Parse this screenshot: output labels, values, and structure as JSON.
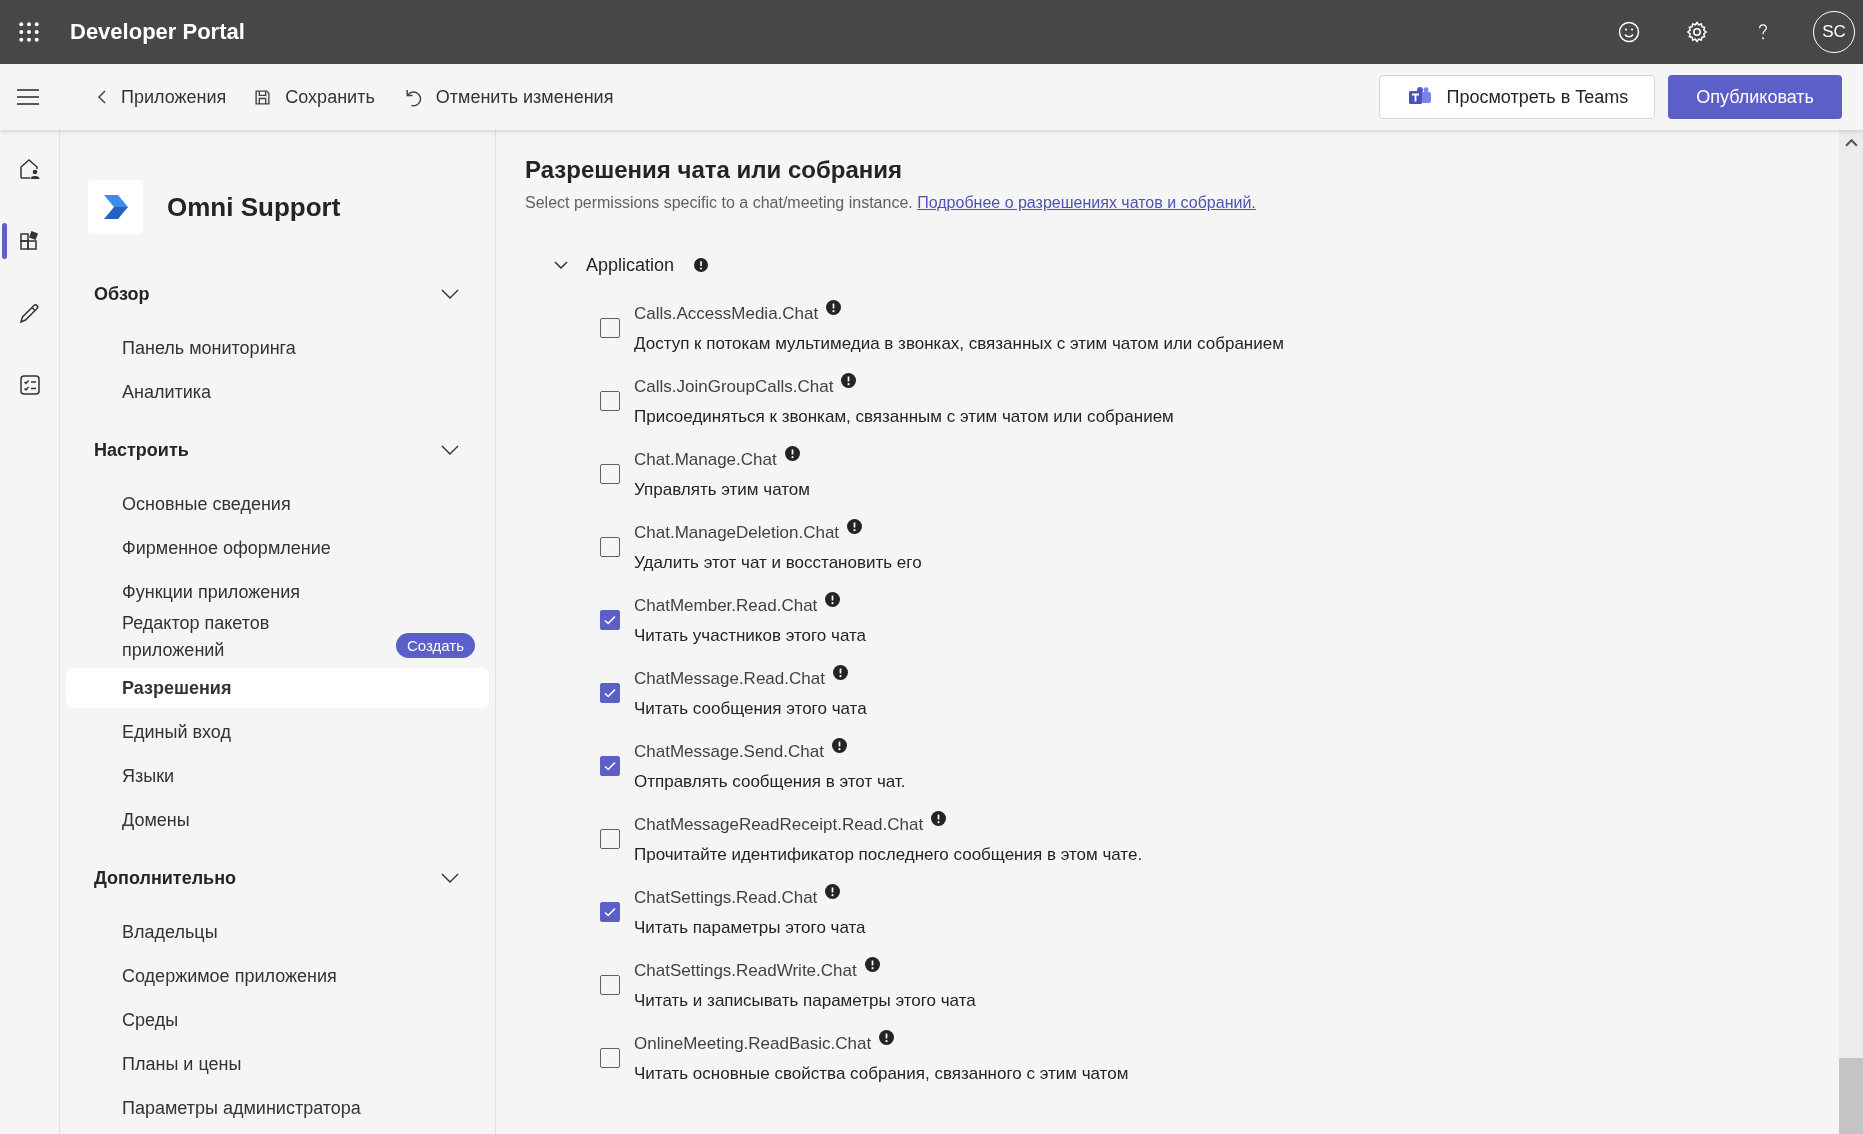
{
  "top_bar": {
    "title": "Developer Portal",
    "avatar": "SC"
  },
  "toolbar": {
    "back": "Приложения",
    "save": "Сохранить",
    "discard": "Отменить изменения",
    "preview": "Просмотреть в Teams",
    "publish": "Опубликовать"
  },
  "rail": [
    {
      "kind": "home",
      "selected": false
    },
    {
      "kind": "apps",
      "selected": true
    },
    {
      "kind": "edit",
      "selected": false
    },
    {
      "kind": "checklist",
      "selected": false
    }
  ],
  "app": {
    "name": "Omni Support"
  },
  "sidebar": [
    {
      "title": "Обзор",
      "expanded": true,
      "items": [
        {
          "label": "Панель мониторинга",
          "selected": false
        },
        {
          "label": "Аналитика",
          "selected": false
        }
      ]
    },
    {
      "title": "Настроить",
      "expanded": true,
      "items": [
        {
          "label": "Основные сведения",
          "selected": false
        },
        {
          "label": "Фирменное оформление",
          "selected": false
        },
        {
          "label": "Функции приложения",
          "selected": false
        },
        {
          "label": "Редактор пакетов приложений",
          "selected": false,
          "badge": "Создать"
        },
        {
          "label": "Разрешения",
          "selected": true
        },
        {
          "label": "Единый вход",
          "selected": false
        },
        {
          "label": "Языки",
          "selected": false
        },
        {
          "label": "Домены",
          "selected": false
        }
      ]
    },
    {
      "title": "Дополнительно",
      "expanded": true,
      "items": [
        {
          "label": "Владельцы",
          "selected": false
        },
        {
          "label": "Содержимое приложения",
          "selected": false
        },
        {
          "label": "Среды",
          "selected": false
        },
        {
          "label": "Планы и цены",
          "selected": false
        },
        {
          "label": "Параметры администратора",
          "selected": false
        }
      ]
    }
  ],
  "content": {
    "title": "Разрешения чата или собрания",
    "subtitle": "Select permissions specific to a chat/meeting instance.",
    "link": "Подробнее о разрешениях чатов и собраний.",
    "group": {
      "title": "Application",
      "expanded": true,
      "permissions": [
        {
          "name": "Calls.AccessMedia.Chat",
          "description": "Доступ к потокам мультимедиа в звонках, связанных с этим чатом или собранием",
          "checked": false
        },
        {
          "name": "Calls.JoinGroupCalls.Chat",
          "description": "Присоединяться к звонкам, связанным с этим чатом или собранием",
          "checked": false
        },
        {
          "name": "Chat.Manage.Chat",
          "description": "Управлять этим чатом",
          "checked": false
        },
        {
          "name": "Chat.ManageDeletion.Chat",
          "description": "Удалить этот чат и восстановить его",
          "checked": false
        },
        {
          "name": "ChatMember.Read.Chat",
          "description": "Читать участников этого чата",
          "checked": true
        },
        {
          "name": "ChatMessage.Read.Chat",
          "description": "Читать сообщения этого чата",
          "checked": true
        },
        {
          "name": "ChatMessage.Send.Chat",
          "description": "Отправлять сообщения в этот чат.",
          "checked": true
        },
        {
          "name": "ChatMessageReadReceipt.Read.Chat",
          "description": "Прочитайте идентификатор последнего сообщения в этом чате.",
          "checked": false
        },
        {
          "name": "ChatSettings.Read.Chat",
          "description": "Читать параметры этого чата",
          "checked": true
        },
        {
          "name": "ChatSettings.ReadWrite.Chat",
          "description": "Читать и записывать параметры этого чата",
          "checked": false
        },
        {
          "name": "OnlineMeeting.ReadBasic.Chat",
          "description": "Читать основные свойства собрания, связанного с этим чатом",
          "checked": false
        }
      ]
    }
  }
}
